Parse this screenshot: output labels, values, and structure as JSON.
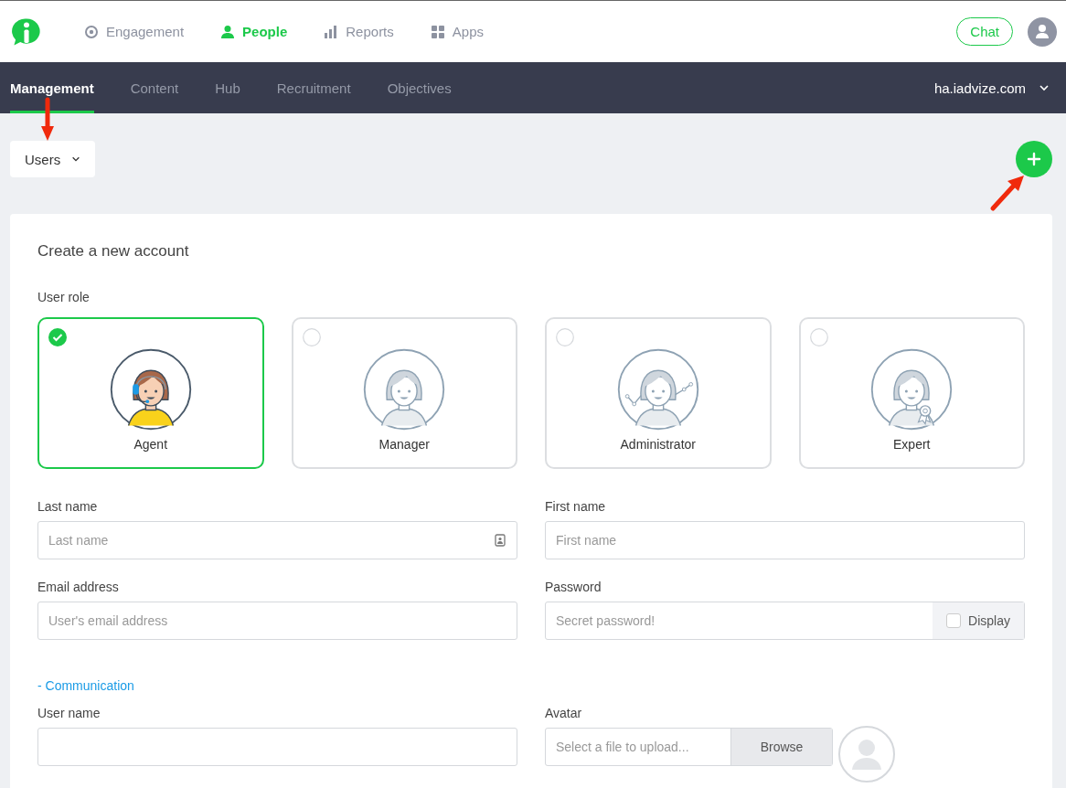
{
  "header": {
    "nav": [
      {
        "label": "Engagement",
        "kind": "target",
        "selected": false
      },
      {
        "label": "People",
        "kind": "person",
        "selected": true
      },
      {
        "label": "Reports",
        "kind": "bars",
        "selected": false
      },
      {
        "label": "Apps",
        "kind": "grid",
        "selected": false
      }
    ],
    "chat_button": "Chat"
  },
  "subnav": {
    "tabs": [
      {
        "label": "Management",
        "selected": true
      },
      {
        "label": "Content",
        "selected": false
      },
      {
        "label": "Hub",
        "selected": false
      },
      {
        "label": "Recruitment",
        "selected": false
      },
      {
        "label": "Objectives",
        "selected": false
      }
    ],
    "account": "ha.iadvize.com"
  },
  "toolbar": {
    "view_select": "Users"
  },
  "form": {
    "title": "Create a new account",
    "role_label": "User role",
    "roles": [
      {
        "label": "Agent",
        "kind": "agent",
        "selected": true
      },
      {
        "label": "Manager",
        "kind": "manager",
        "selected": false
      },
      {
        "label": "Administrator",
        "kind": "administrator",
        "selected": false
      },
      {
        "label": "Expert",
        "kind": "expert",
        "selected": false
      }
    ],
    "fields": [
      {
        "label": "Last name",
        "placeholder": "Last name",
        "kind": "contact"
      },
      {
        "label": "First name",
        "placeholder": "First name",
        "kind": "text"
      },
      {
        "label": "Email address",
        "placeholder": "User's email address",
        "kind": "text"
      },
      {
        "label": "Password",
        "placeholder": "Secret password!",
        "kind": "password",
        "toggle_label": "Display",
        "checked": false
      }
    ],
    "section_link": "- Communication",
    "username": {
      "label": "User name"
    },
    "avatar": {
      "label": "Avatar",
      "placeholder": "Select a file to upload...",
      "button": "Browse"
    }
  }
}
